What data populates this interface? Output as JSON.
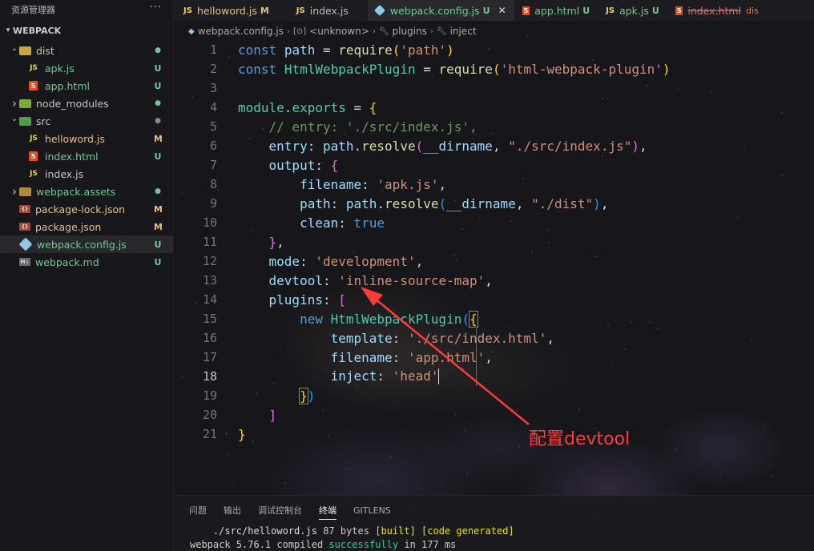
{
  "sidebar": {
    "header_title": "资源管理器",
    "more_label": "···",
    "section_title": "WEBPACK",
    "items": [
      {
        "label": "dist",
        "kind": "folder",
        "arrow": "open",
        "status": "●",
        "status_kind": "dot",
        "indent": 1
      },
      {
        "label": "apk.js",
        "kind": "js",
        "status": "U",
        "status_kind": "U",
        "indent": 2,
        "color": "green"
      },
      {
        "label": "app.html",
        "kind": "html",
        "status": "U",
        "status_kind": "U",
        "indent": 2,
        "color": "green"
      },
      {
        "label": "node_modules",
        "kind": "folder-green",
        "arrow": "closed",
        "status": "●",
        "status_kind": "dot",
        "indent": 1
      },
      {
        "label": "src",
        "kind": "folder-src",
        "arrow": "open",
        "status": "●",
        "status_kind": "dotgray",
        "indent": 1
      },
      {
        "label": "helloword.js",
        "kind": "js",
        "status": "M",
        "status_kind": "M",
        "indent": 2,
        "color": "yellow"
      },
      {
        "label": "index.html",
        "kind": "html",
        "status": "U",
        "status_kind": "U",
        "indent": 2,
        "color": "green"
      },
      {
        "label": "index.js",
        "kind": "js",
        "status": "",
        "status_kind": "",
        "indent": 2,
        "color": ""
      },
      {
        "label": "webpack.assets",
        "kind": "folder-assets",
        "arrow": "closed",
        "status": "●",
        "status_kind": "dot",
        "indent": 1,
        "color": "green"
      },
      {
        "label": "package-lock.json",
        "kind": "json",
        "status": "M",
        "status_kind": "M",
        "indent": 1,
        "color": "yellow"
      },
      {
        "label": "package.json",
        "kind": "json",
        "status": "M",
        "status_kind": "M",
        "indent": 1,
        "color": "yellow"
      },
      {
        "label": "webpack.config.js",
        "kind": "webpack",
        "status": "U",
        "status_kind": "U",
        "indent": 1,
        "color": "green",
        "selected": true
      },
      {
        "label": "webpack.md",
        "kind": "md",
        "status": "U",
        "status_kind": "U",
        "indent": 1,
        "color": "green"
      }
    ]
  },
  "tabs": [
    {
      "label": "helloword.js",
      "icon": "JS",
      "status": "M",
      "color": "yellow"
    },
    {
      "label": "index.js",
      "icon": "JS",
      "status": "",
      "color": ""
    },
    {
      "label": "webpack.config.js",
      "icon": "wp",
      "status": "U",
      "color": "green",
      "active": true,
      "close": "✕"
    },
    {
      "label": "app.html",
      "icon": "5",
      "status": "U",
      "color": "green"
    },
    {
      "label": "apk.js",
      "icon": "JS",
      "status": "U",
      "color": "green"
    },
    {
      "label": "index.html",
      "icon": "5",
      "status": "",
      "color": "",
      "deleted": true,
      "suffix": "dis"
    }
  ],
  "breadcrumb": {
    "file": "webpack.config.js",
    "unknown": "<unknown>",
    "plugins": "plugins",
    "inject": "inject",
    "sep": "›"
  },
  "editor": {
    "current_line": 18,
    "line_numbers": [
      "1",
      "2",
      "3",
      "4",
      "5",
      "6",
      "7",
      "8",
      "9",
      "10",
      "11",
      "12",
      "13",
      "14",
      "15",
      "16",
      "17",
      "18",
      "19",
      "20",
      "21"
    ]
  },
  "annotation": {
    "text": "配置devtool",
    "color": "#ff3b3b"
  },
  "panel": {
    "tabs": [
      "问题",
      "输出",
      "调试控制台",
      "终端",
      "GITLENS"
    ],
    "active_tab": "终端",
    "terminal": {
      "line1_path": "./src/helloword.js",
      "line1_size": "87 bytes",
      "line1_built": "[built]",
      "line1_generated": "[code generated]",
      "line2_prefix": "webpack 5.76.1 compiled",
      "line2_success": "successfully",
      "line2_suffix": "in 177 ms"
    }
  },
  "colors": {
    "accent_green": "#73c991",
    "modified_yellow": "#e2c08d",
    "keyword": "#569cd6",
    "string": "#ce9178"
  }
}
